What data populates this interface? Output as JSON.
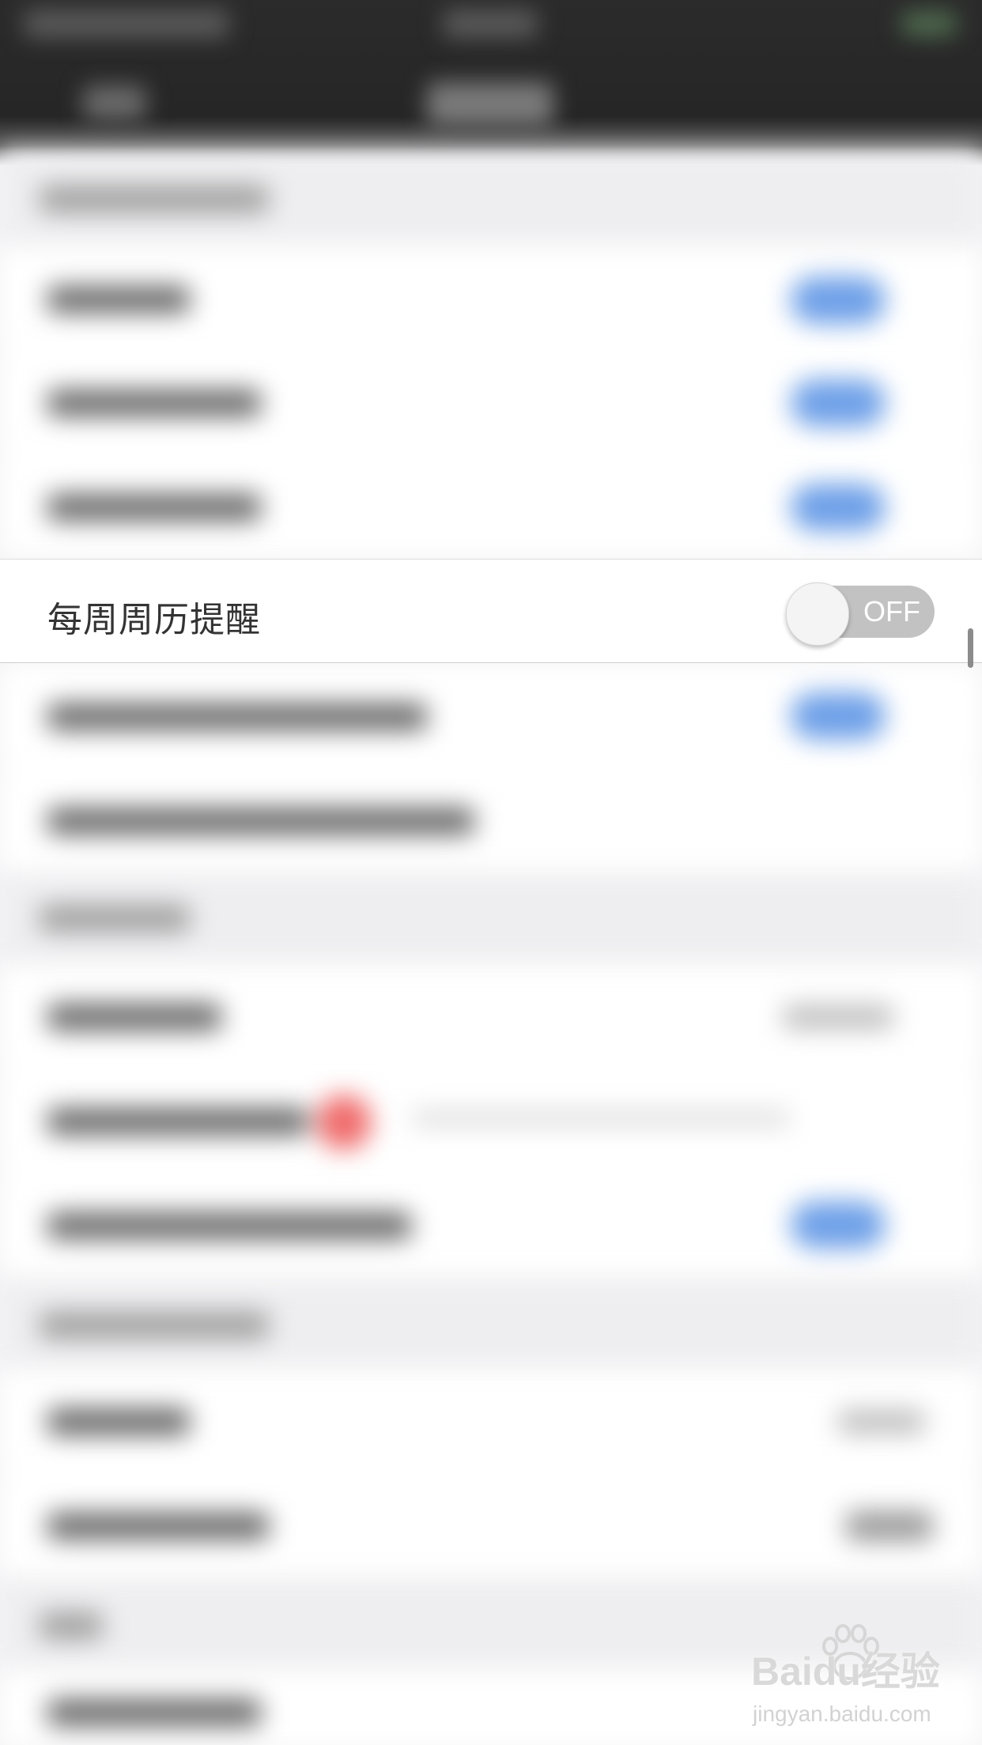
{
  "focused_setting": {
    "label": "每周周历提醒",
    "toggle_state_label": "OFF",
    "toggle_on": false
  },
  "watermark": {
    "logo_text": "Baidu经验",
    "url": "jingyan.baidu.com"
  },
  "colors": {
    "toggle_off": "#c2c2c2",
    "toggle_on_blurred": "#6ea0e8",
    "badge_red": "#f06b6b",
    "nav_dark": "#262626"
  }
}
